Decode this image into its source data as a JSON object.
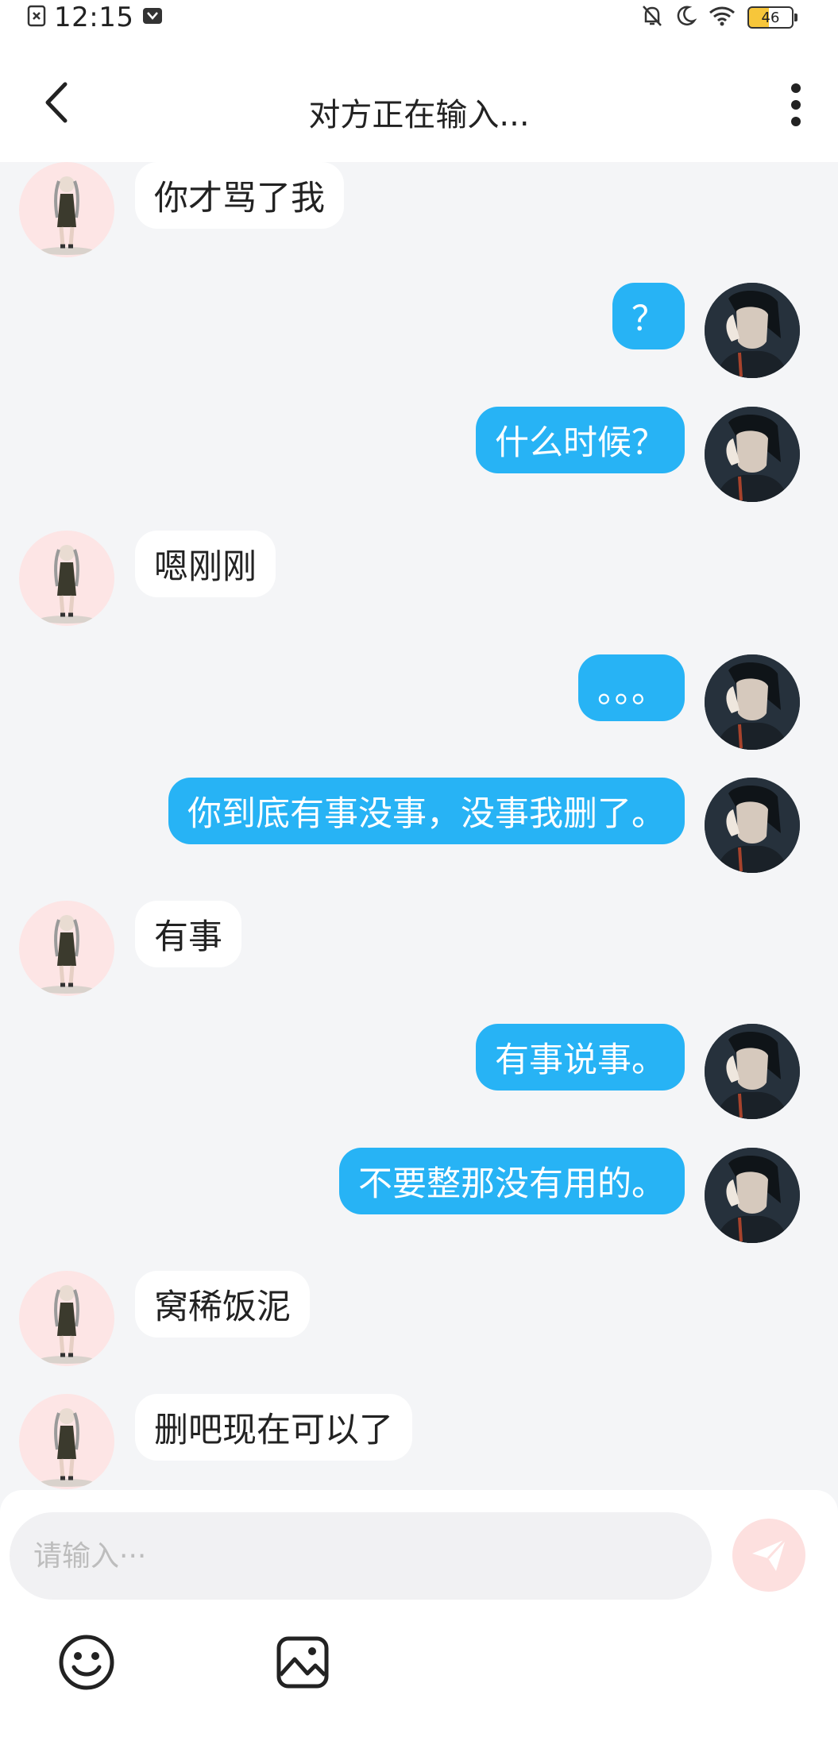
{
  "status_bar": {
    "time": "12:15",
    "battery": "46"
  },
  "header": {
    "title": "对方正在输入..."
  },
  "messages": [
    {
      "side": "other",
      "text": "你才骂了我"
    },
    {
      "side": "me",
      "text": "？"
    },
    {
      "side": "me",
      "text": "什么时候？"
    },
    {
      "side": "other",
      "text": "嗯刚刚"
    },
    {
      "side": "me",
      "text": "。。。"
    },
    {
      "side": "me",
      "text": "你到底有事没事，没事我删了。"
    },
    {
      "side": "other",
      "text": "有事"
    },
    {
      "side": "me",
      "text": "有事说事。"
    },
    {
      "side": "me",
      "text": "不要整那没有用的。"
    },
    {
      "side": "other",
      "text": "窝稀饭泥"
    },
    {
      "side": "other",
      "text": "删吧现在可以了"
    }
  ],
  "input": {
    "placeholder": "请输入···",
    "value": ""
  },
  "icons": {
    "back": "chevron-left-icon",
    "more": "more-vertical-icon",
    "send": "paper-plane-icon",
    "emoji": "smiley-icon",
    "image": "image-icon"
  },
  "colors": {
    "my_bubble": "#27b3f5",
    "other_bubble": "#ffffff",
    "chat_background": "#f4f5f7",
    "send_button_disabled": "#fde0df"
  }
}
